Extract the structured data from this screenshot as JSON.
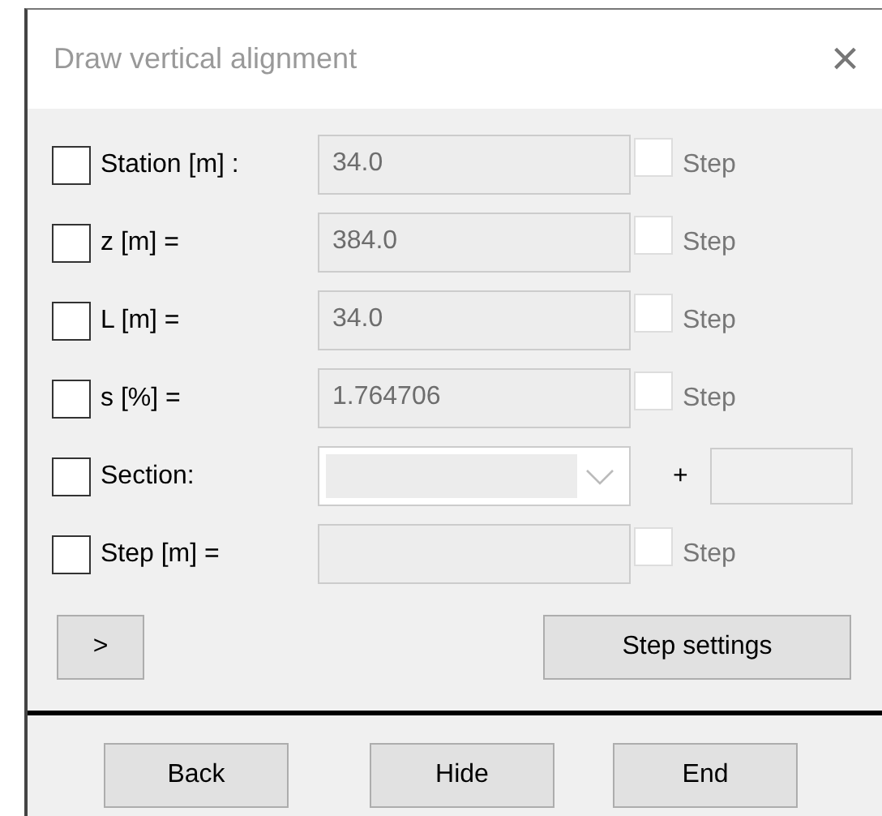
{
  "window": {
    "title": "Draw vertical alignment",
    "close": "×"
  },
  "rows": [
    {
      "kind": "field",
      "checked": false,
      "label": "Station [m] :",
      "value": "34.0",
      "disabled": true,
      "step": {
        "label": "Step",
        "checked": false
      }
    },
    {
      "kind": "field",
      "checked": false,
      "label": "z [m] =",
      "value": "384.0",
      "disabled": true,
      "step": {
        "label": "Step",
        "checked": false
      }
    },
    {
      "kind": "field",
      "checked": false,
      "label": "L [m] =",
      "value": "34.0",
      "disabled": true,
      "step": {
        "label": "Step",
        "checked": false
      }
    },
    {
      "kind": "field",
      "checked": false,
      "label": "s [%] =",
      "value": "1.764706",
      "disabled": true,
      "step": {
        "label": "Step",
        "checked": false
      }
    },
    {
      "kind": "dropdown",
      "checked": false,
      "label": "Section:",
      "disabled": true,
      "plus": "+"
    },
    {
      "kind": "field",
      "checked": false,
      "label": "Step [m] =",
      "disabled": true,
      "step": {
        "label": "Step",
        "checked": false
      }
    }
  ],
  "expand_button": ">",
  "step_settings_button": "Step settings",
  "footer_buttons": [
    "Back",
    "Hide",
    "End"
  ]
}
